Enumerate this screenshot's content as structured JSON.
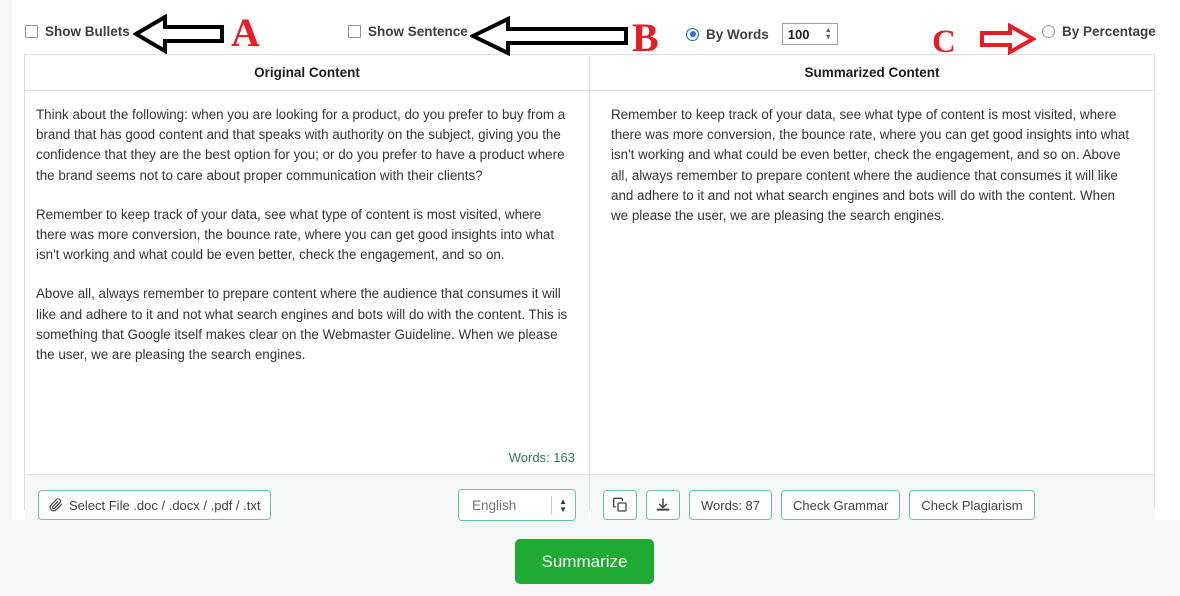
{
  "options": {
    "show_bullets_label": "Show Bullets",
    "show_sentence_label": "Show Sentence",
    "by_words_label": "By Words",
    "by_words_value": "100",
    "by_percentage_label": "By Percentage"
  },
  "left_panel": {
    "title": "Original Content",
    "paragraphs": [
      "Think about the following: when you are looking for a product, do you prefer to buy from a brand that has good content and that speaks with authority on the subject, giving you the confidence that they are the best option for you; or do you prefer to have a product where the brand seems not to care about proper communication with their clients?",
      "Remember to keep track of your data, see what type of content is most visited, where there was more conversion, the bounce rate, where you can get good insights into what isn't working and what could be even better, check the engagement, and so on.",
      "Above all, always remember to prepare content where the audience that consumes it will like and adhere to it and not what search engines and bots will do with the content. This is something that Google itself makes clear on the Webmaster Guideline. When we please the user, we are pleasing the search engines."
    ],
    "word_count": "Words: 163",
    "select_file_label": "Select File .doc / .docx / .pdf / .txt",
    "language_value": "English"
  },
  "right_panel": {
    "title": "Summarized Content",
    "paragraphs": [
      "Remember to keep track of your data, see what type of content is most visited, where there was more conversion, the bounce rate, where you can get good insights into what isn't working and what could be even better, check the engagement, and so on. Above all, always remember to prepare content where the audience that consumes it will like and adhere to it and not what search engines and bots will do with the content. When we please the user, we are pleasing the search engines."
    ],
    "word_count": "Words: 87",
    "check_grammar_label": "Check Grammar",
    "check_plagiarism_label": "Check Plagiarism"
  },
  "summarize_button_label": "Summarize",
  "annotations": {
    "a": "A",
    "b": "B",
    "c": "C"
  },
  "colors": {
    "summarize_green": "#1faa33",
    "button_border_green": "#63c79a",
    "word_count_green": "#2e7d4f",
    "radio_blue": "#1a73e8",
    "annotation_red": "#e81c24"
  }
}
